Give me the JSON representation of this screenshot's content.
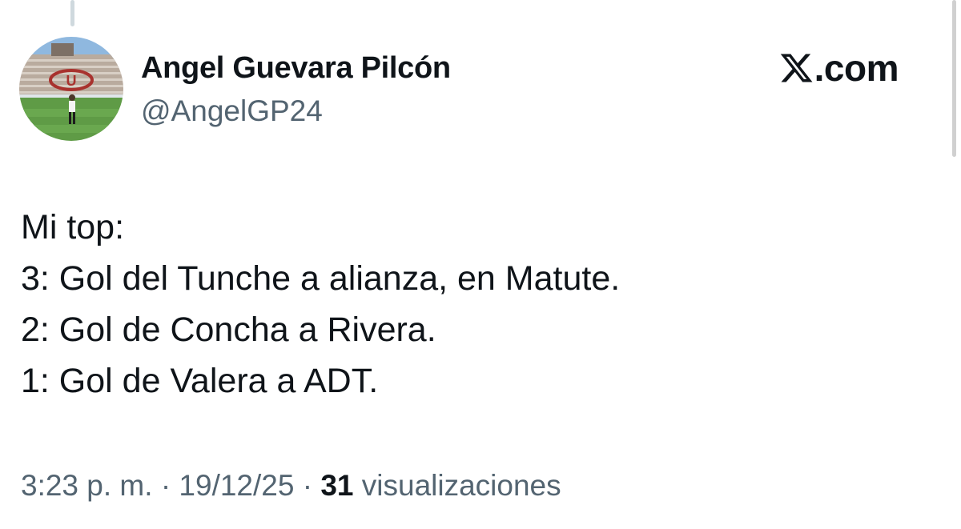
{
  "author": {
    "display_name": "Angel Guevara Pilcón",
    "handle": "@AngelGP24"
  },
  "brand": {
    "icon": "x-logo-icon",
    "text": ".com"
  },
  "tweet": {
    "lines": [
      "Mi top:",
      "3: Gol del Tunche a alianza, en Matute.",
      "2: Gol de Concha a Rivera.",
      "1: Gol de Valera a ADT."
    ]
  },
  "meta": {
    "time": "3:23 p. m.",
    "separator": "·",
    "date": "19/12/25",
    "views_count": "31",
    "views_label": "visualizaciones"
  },
  "colors": {
    "text": "#0f1419",
    "secondary": "#536471",
    "thread_line": "#cfd9de"
  }
}
